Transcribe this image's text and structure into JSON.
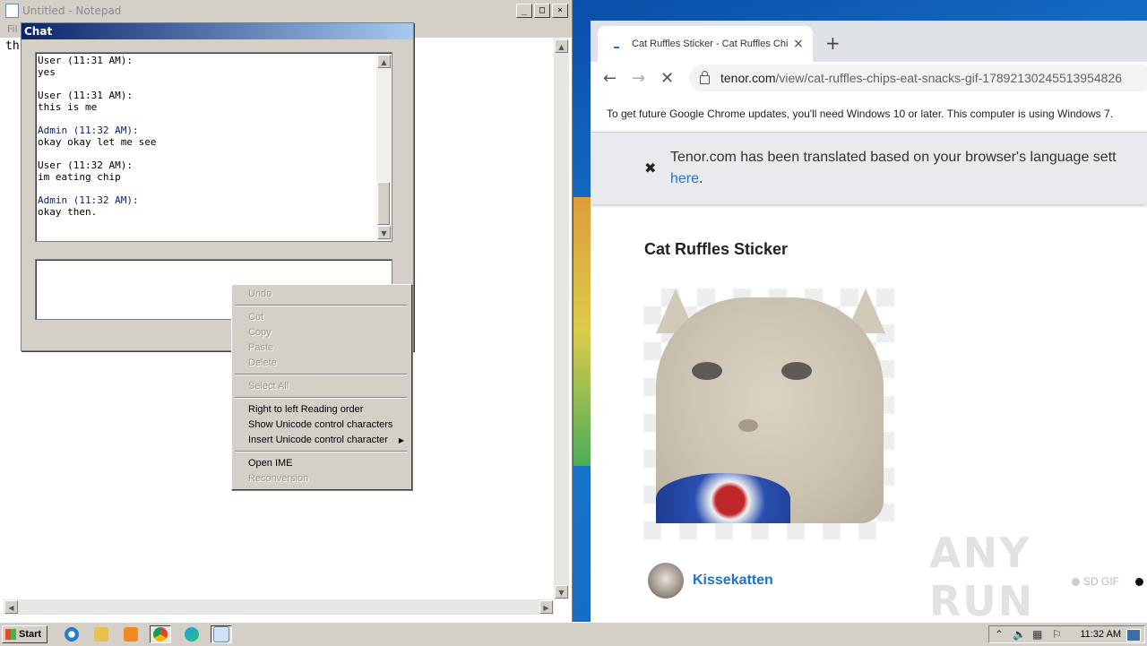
{
  "notepad": {
    "title": "Untitled - Notepad",
    "menu_label": "Fil",
    "text": "th",
    "controls": {
      "minimize": "_",
      "maximize": "□",
      "close": "×"
    }
  },
  "chat": {
    "title": "Chat",
    "messages": [
      {
        "header": "User (11:31 AM):",
        "text": "yes",
        "role": "user"
      },
      {
        "header": "User (11:31 AM):",
        "text": "this is me",
        "role": "user"
      },
      {
        "header": "Admin (11:32 AM):",
        "text": "okay okay let me see",
        "role": "admin"
      },
      {
        "header": "User (11:32 AM):",
        "text": "im eating chip",
        "role": "user"
      },
      {
        "header": "Admin (11:32 AM):",
        "text": "okay then.",
        "role": "admin"
      }
    ],
    "input_value": ""
  },
  "context_menu": {
    "items": [
      {
        "label": "Undo",
        "enabled": false
      },
      {
        "label": "Cut",
        "enabled": false
      },
      {
        "label": "Copy",
        "enabled": false
      },
      {
        "label": "Paste",
        "enabled": false
      },
      {
        "label": "Delete",
        "enabled": false
      },
      {
        "label": "Select All",
        "enabled": false
      },
      {
        "label": "Right to left Reading order",
        "enabled": true
      },
      {
        "label": "Show Unicode control characters",
        "enabled": true
      },
      {
        "label": "Insert Unicode control character",
        "enabled": true,
        "submenu": true
      },
      {
        "label": "Open IME",
        "enabled": true
      },
      {
        "label": "Reconversion",
        "enabled": false
      }
    ]
  },
  "browser": {
    "tab_title": "Cat Ruffles Sticker - Cat Ruffles Chips",
    "tab_close": "×",
    "new_tab": "+",
    "url_domain": "tenor.com",
    "url_path": "/view/cat-ruffles-chips-eat-snacks-gif-17892130245513954826",
    "update_notice": "To get future Google Chrome updates, you'll need Windows 10 or later. This computer is using Windows 7.",
    "translate_line1": "Tenor.com has been translated based on your browser's language sett",
    "translate_link": "here",
    "translate_tail": ".",
    "page_title": "Cat Ruffles Sticker",
    "author": "Kissekatten",
    "quality_label": "SD GIF",
    "watermark": "ANY RUN"
  },
  "taskbar": {
    "start_label": "Start",
    "clock": "11:32 AM"
  }
}
